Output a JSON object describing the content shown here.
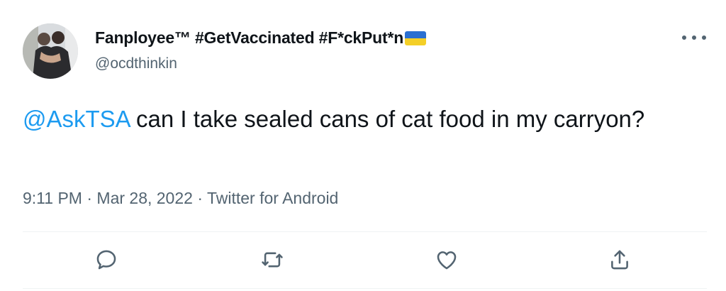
{
  "author": {
    "display_name": "Fanployee™ #GetVaccinated #F*ckPut*n",
    "handle": "@ocdthinkin",
    "avatar": "profile-photo"
  },
  "tweet": {
    "mention": "@AskTSA",
    "text": " can I take sealed cans of  cat food in my carryon?"
  },
  "meta": {
    "time": "9:11 PM",
    "date": "Mar 28, 2022",
    "source": "Twitter for Android",
    "separator": "·"
  },
  "icons": {
    "more": "more-dots-icon",
    "reply": "reply-icon",
    "retweet": "retweet-icon",
    "like": "heart-icon",
    "share": "share-icon"
  },
  "colors": {
    "link": "#1d9bf0",
    "secondary_text": "#536471",
    "flag_blue": "#2a6fd1",
    "flag_yellow": "#f4cf27"
  }
}
